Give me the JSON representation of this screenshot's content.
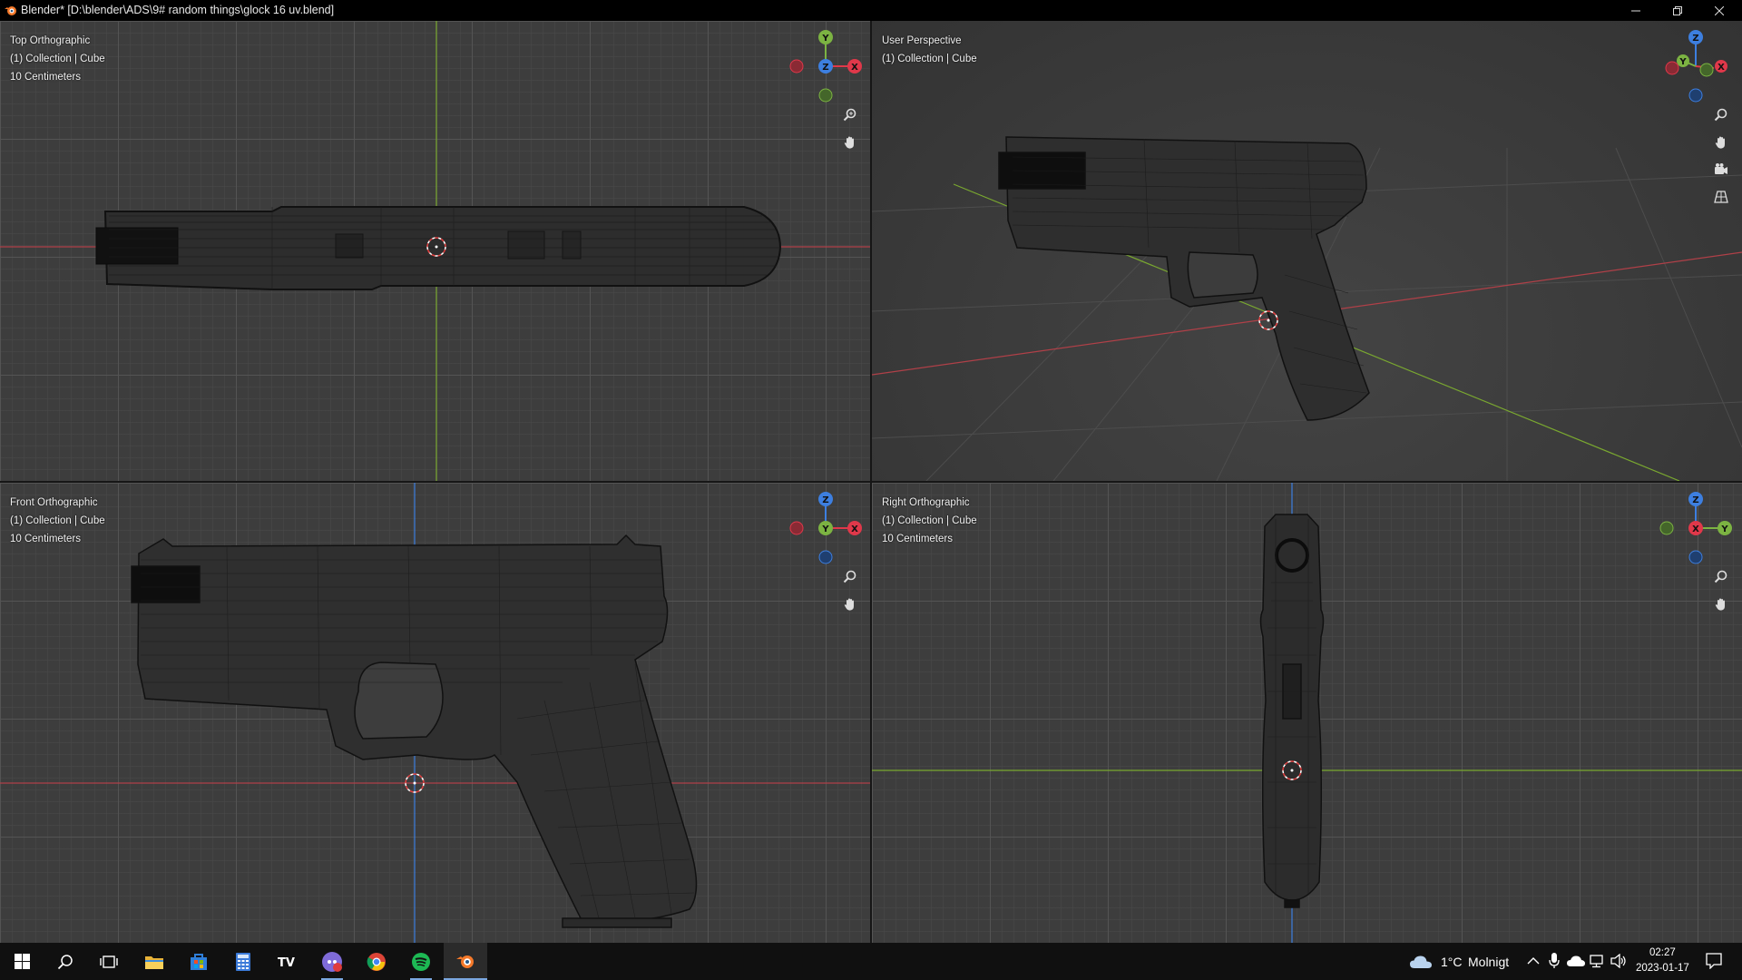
{
  "window": {
    "title": "Blender* [D:\\blender\\ADS\\9# random things\\glock 16 uv.blend]",
    "app_icon": "blender-icon",
    "controls": [
      "minimize-icon",
      "restore-icon",
      "close-icon"
    ]
  },
  "viewports": [
    {
      "id": "top",
      "view_name": "Top Orthographic",
      "collection": "(1) Collection | Cube",
      "scale": "10 Centimeters",
      "gizmo": [
        "Y",
        "Z",
        "X"
      ]
    },
    {
      "id": "user",
      "view_name": "User Perspective",
      "collection": "(1) Collection | Cube",
      "scale": "",
      "gizmo": [
        "Z",
        "Y",
        "X"
      ]
    },
    {
      "id": "front",
      "view_name": "Front Orthographic",
      "collection": "(1) Collection | Cube",
      "scale": "10 Centimeters",
      "gizmo": [
        "Z",
        "Y",
        "X"
      ]
    },
    {
      "id": "right",
      "view_name": "Right Orthographic",
      "collection": "(1) Collection | Cube",
      "scale": "10 Centimeters",
      "gizmo": [
        "Z",
        "X",
        "Y"
      ]
    }
  ],
  "colors": {
    "axis_x": "#e0384a",
    "axis_y": "#7cb342",
    "axis_z": "#3d7fe0",
    "viewport_bg": "#3d3d3d",
    "wire": "#111111"
  },
  "taskbar": {
    "apps": [
      "windows-start-icon",
      "search-icon",
      "task-view-icon",
      "file-explorer-icon",
      "store-icon",
      "calculator-icon",
      "tidal-icon",
      "discord-icon",
      "chrome-icon",
      "spotify-icon",
      "blender-icon"
    ],
    "weather_temp": "1°C",
    "weather_desc": "Molnigt",
    "time": "02:27",
    "date": "2023-01-17"
  }
}
